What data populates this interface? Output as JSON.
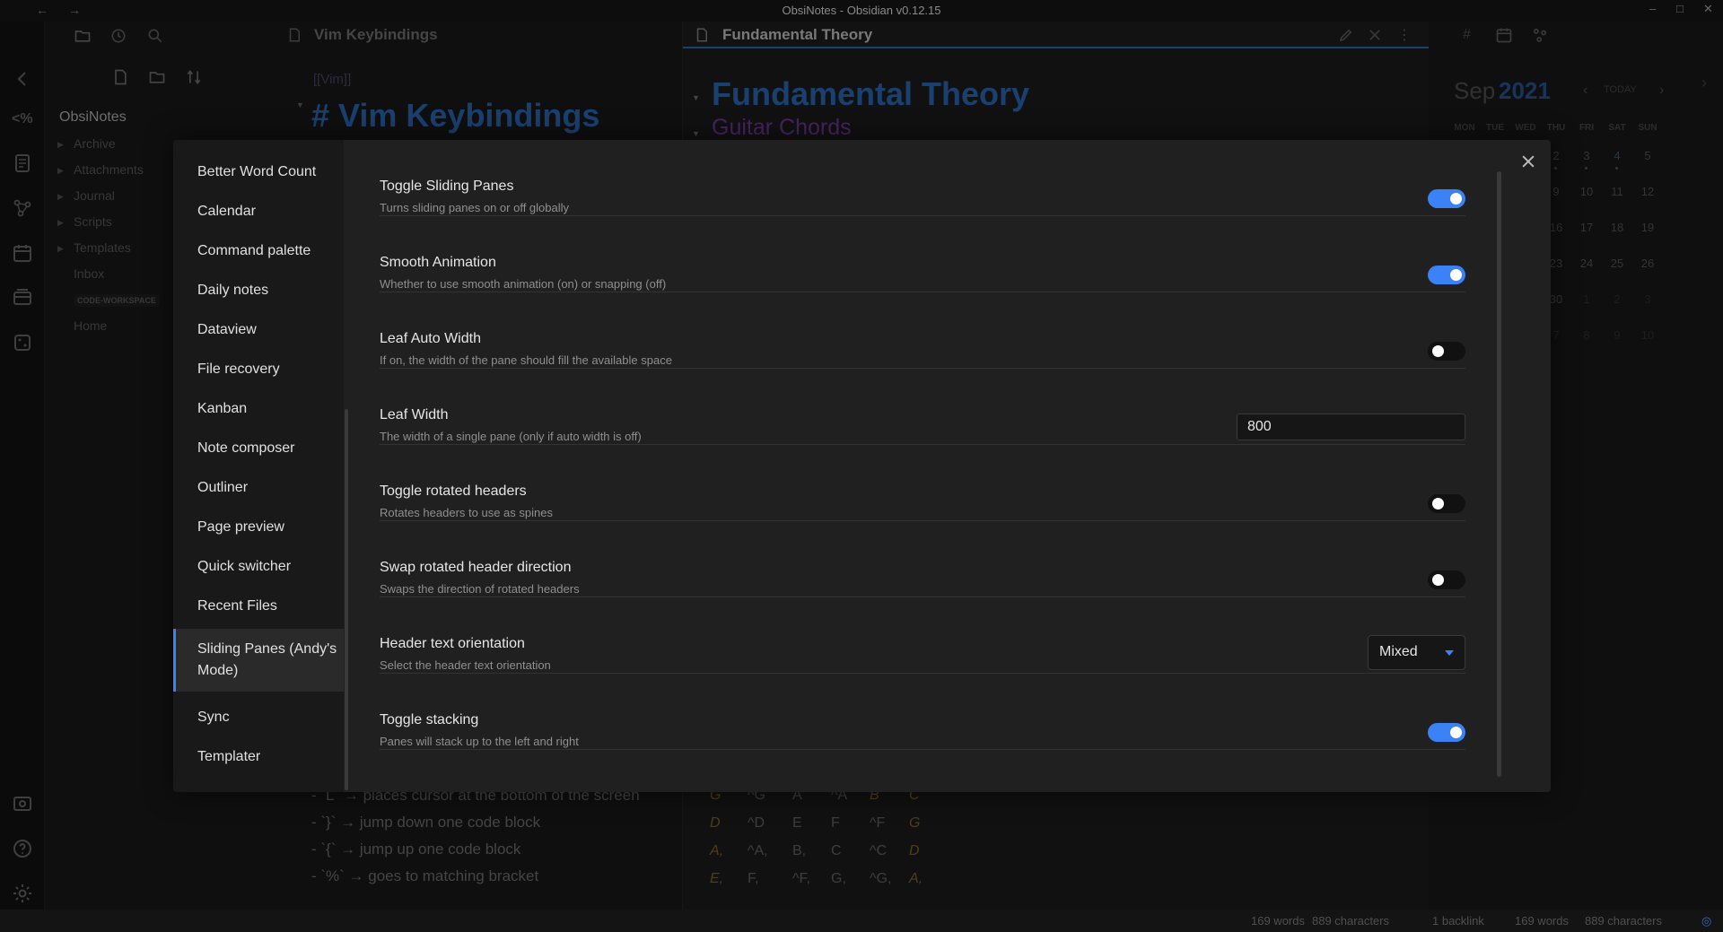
{
  "window": {
    "title": "ObsiNotes - Obsidian v0.12.15"
  },
  "vault": {
    "name": "ObsiNotes",
    "tree": [
      {
        "label": "Archive",
        "folder": true
      },
      {
        "label": "Attachments",
        "folder": true
      },
      {
        "label": "Journal",
        "folder": true
      },
      {
        "label": "Scripts",
        "folder": true
      },
      {
        "label": "Templates",
        "folder": true
      },
      {
        "label": "Inbox",
        "folder": false
      },
      {
        "label": "CODE-WORKSPACE",
        "folder": false
      },
      {
        "label": "Home",
        "folder": false
      }
    ]
  },
  "pane1": {
    "title": "Vim Keybindings",
    "link_text": "[[Vim]]",
    "heading": "# Vim Keybindings",
    "bullets": [
      "- `L` → places cursor at the bottom of the screen",
      "- `}` → jump down one code block",
      "- `{` → jump up one code block",
      "- `%` → goes to matching bracket"
    ]
  },
  "pane2": {
    "title": "Fundamental Theory",
    "heading": "Fundamental Theory",
    "subheading": "Guitar Chords",
    "chord_rows": [
      [
        "G",
        "^G",
        "A",
        "^A",
        "B",
        "C"
      ],
      [
        "D",
        "^D",
        "E",
        "F",
        "^F",
        "G"
      ],
      [
        "A,",
        "^A,",
        "B,",
        "C",
        "^C",
        "D"
      ],
      [
        "E,",
        "F,",
        "^F,",
        "G,",
        "^G,",
        "A,"
      ]
    ]
  },
  "calendar": {
    "month": "Sep",
    "year": "2021",
    "today_label": "TODAY",
    "dow": [
      "MON",
      "TUE",
      "WED",
      "THU",
      "FRI",
      "SAT",
      "SUN"
    ],
    "weeks": [
      [
        "2",
        "3",
        "4",
        "5"
      ],
      [
        "9",
        "10",
        "11",
        "12"
      ],
      [
        "16",
        "17",
        "18",
        "19"
      ],
      [
        "23",
        "24",
        "25",
        "26"
      ],
      [
        "30",
        "1",
        "2",
        "3"
      ],
      [
        "7",
        "8",
        "9",
        "10"
      ]
    ],
    "accent": "#3b82f6"
  },
  "statusbar": {
    "words_left": "169 words",
    "chars_left": "889 characters",
    "backlinks": "1 backlink",
    "words_right": "169 words",
    "chars_right": "889 characters"
  },
  "settings_nav": {
    "items": [
      "Better Word Count",
      "Calendar",
      "Command palette",
      "Daily notes",
      "Dataview",
      "File recovery",
      "Kanban",
      "Note composer",
      "Outliner",
      "Page preview",
      "Quick switcher",
      "Recent Files",
      "Sliding Panes (Andy's Mode)",
      "Sync",
      "Templater"
    ],
    "active": "Sliding Panes (Andy's Mode)"
  },
  "settings": [
    {
      "name": "Toggle Sliding Panes",
      "desc": "Turns sliding panes on or off globally",
      "control": "toggle",
      "value": true
    },
    {
      "name": "Smooth Animation",
      "desc": "Whether to use smooth animation (on) or snapping (off)",
      "control": "toggle",
      "value": true
    },
    {
      "name": "Leaf Auto Width",
      "desc": "If on, the width of the pane should fill the available space",
      "control": "toggle",
      "value": false
    },
    {
      "name": "Leaf Width",
      "desc": "The width of a single pane (only if auto width is off)",
      "control": "text",
      "value": "800"
    },
    {
      "name": "Toggle rotated headers",
      "desc": "Rotates headers to use as spines",
      "control": "toggle",
      "value": false
    },
    {
      "name": "Swap rotated header direction",
      "desc": "Swaps the direction of rotated headers",
      "control": "toggle",
      "value": false
    },
    {
      "name": "Header text orientation",
      "desc": "Select the header text orientation",
      "control": "dropdown",
      "value": "Mixed"
    },
    {
      "name": "Toggle stacking",
      "desc": "Panes will stack up to the left and right",
      "control": "toggle",
      "value": true
    }
  ],
  "colors": {
    "accent": "#3b82f6",
    "heading_blue": "#2e6fc2",
    "heading_purple": "#7a3fa8",
    "chord_orange": "#b8860b"
  }
}
